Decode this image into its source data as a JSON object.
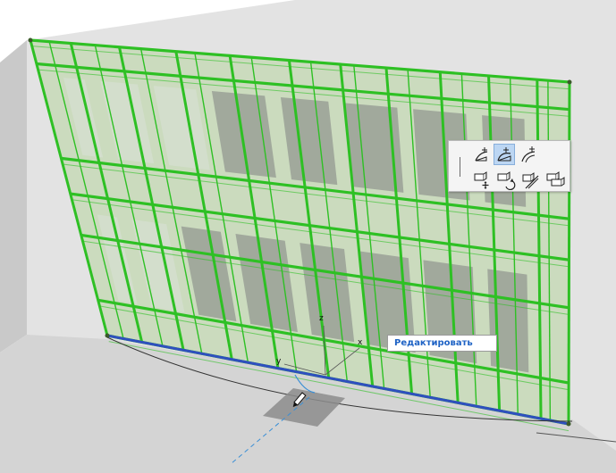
{
  "viewport": {
    "tracker": {
      "label": "Редактировать"
    },
    "axes": {
      "x": "x",
      "y": "y",
      "z": "z"
    },
    "pet_palette": {
      "buttons": [
        {
          "icon": "arc-tangent-edit-icon",
          "active": false
        },
        {
          "icon": "arc-curve-edit-icon",
          "active": true
        },
        {
          "icon": "arc-offset-edit-icon",
          "active": false
        },
        {
          "icon": "move-node-icon",
          "active": false
        },
        {
          "icon": "rotate-node-icon",
          "active": false
        },
        {
          "icon": "offset-segment-icon",
          "active": false
        },
        {
          "icon": "stretch-segment-icon",
          "active": false
        }
      ]
    }
  },
  "colors": {
    "wall_front": "#e3e3e3",
    "wall_side": "#c9c9c9",
    "glass_panel": "#cfe1c3",
    "mullion": "#2ec024",
    "opening_dark": "#7d7d7d",
    "opening_light": "#d7dcd3",
    "base_line": "#2f4fbf",
    "tracker_text": "#1f63c5",
    "palette_active": "#bcd6f3"
  }
}
